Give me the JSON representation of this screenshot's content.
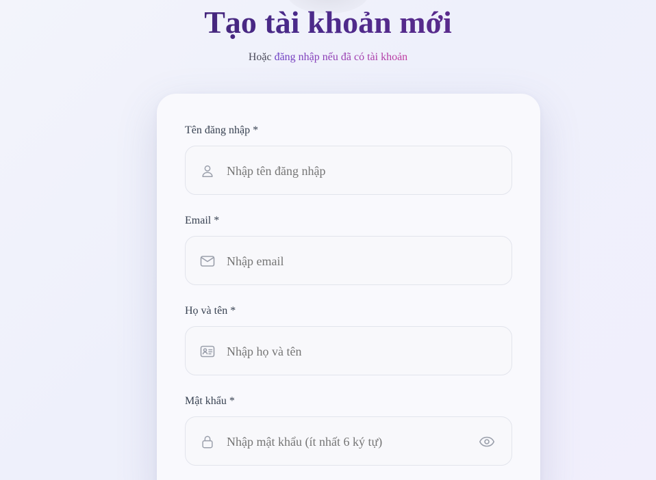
{
  "header": {
    "title": "Tạo tài khoản mới",
    "subtitle_prefix": "Hoặc",
    "login_link": "đăng nhập nếu đã có tài khoản"
  },
  "form": {
    "fields": [
      {
        "label": "Tên đăng nhập *",
        "placeholder": "Nhập tên đăng nhập",
        "icon": "user-icon"
      },
      {
        "label": "Email *",
        "placeholder": "Nhập email",
        "icon": "mail-icon"
      },
      {
        "label": "Họ và tên *",
        "placeholder": "Nhập họ và tên",
        "icon": "id-card-icon"
      },
      {
        "label": "Mật khẩu *",
        "placeholder": "Nhập mật khẩu (ít nhất 6 ký tự)",
        "icon": "lock-icon",
        "toggle_icon": "eye-icon"
      }
    ]
  },
  "colors": {
    "title_gradient_start": "#3b1f5e",
    "title_gradient_end": "#6d2a8f",
    "link_color": "#a02ab3",
    "icon_color": "#9a9fab",
    "card_background": "#f9f9fd"
  }
}
